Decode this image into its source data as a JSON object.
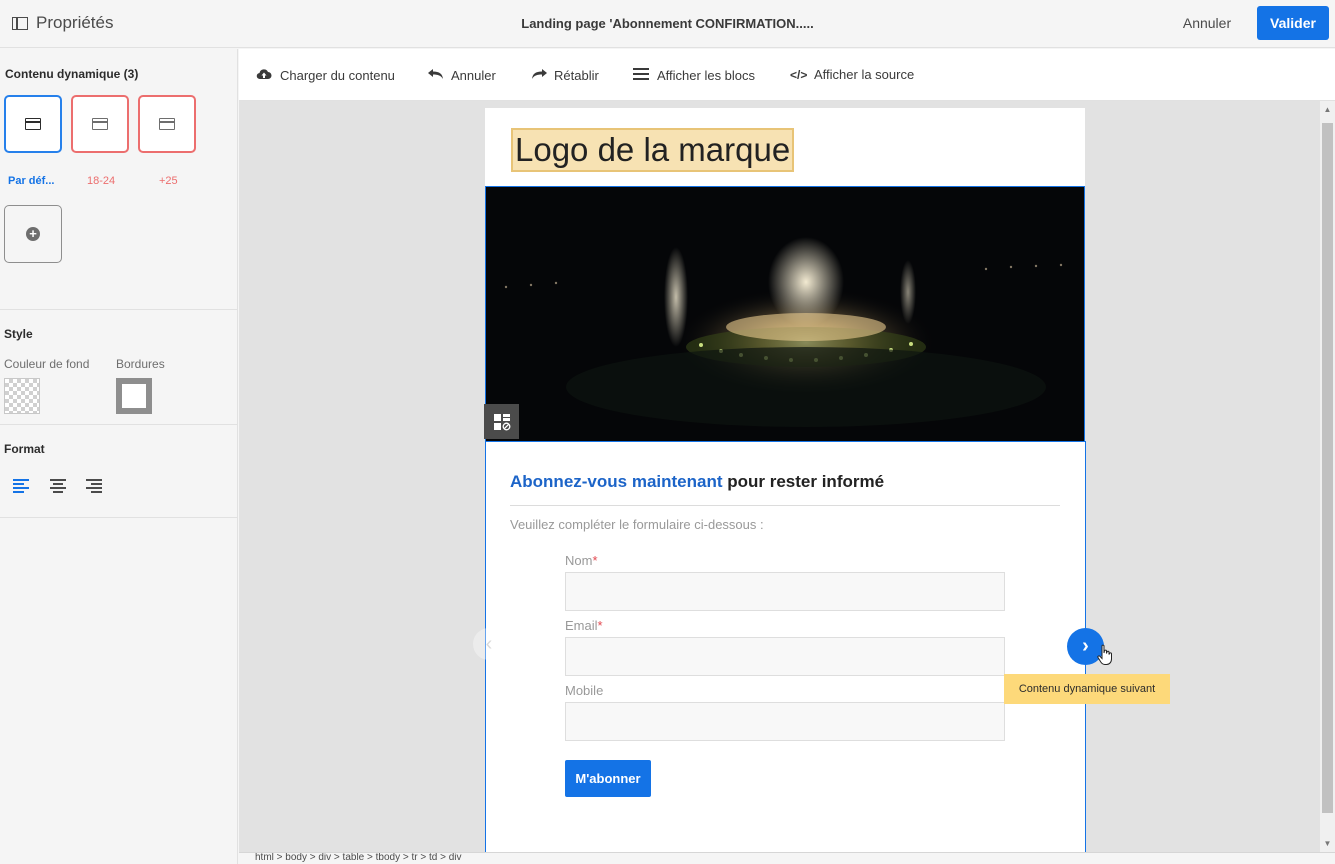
{
  "topbar": {
    "panel_title": "Propriétés",
    "doc_title": "Landing page 'Abonnement CONFIRMATION.....",
    "cancel_label": "Annuler",
    "validate_label": "Valider"
  },
  "left_panel": {
    "dynamic_title": "Contenu dynamique (3)",
    "variants": [
      {
        "label": "Par déf...",
        "icon": "window-icon",
        "state": "selected"
      },
      {
        "label": "18-24",
        "icon": "window-icon",
        "state": "variant"
      },
      {
        "label": "+25",
        "icon": "window-icon",
        "state": "variant"
      }
    ],
    "add_icon": "plus-circle-icon",
    "style_title": "Style",
    "bg_color_label": "Couleur de fond",
    "borders_label": "Bordures",
    "format_title": "Format",
    "alignments": [
      "align-left-icon",
      "align-center-icon",
      "align-right-icon"
    ]
  },
  "toolbar": {
    "load_label": "Charger du contenu",
    "undo_label": "Annuler",
    "redo_label": "Rétablir",
    "blocks_label": "Afficher les blocs",
    "source_label": "Afficher la source"
  },
  "page": {
    "logo_text": "Logo de la marque",
    "headline_blue": "Abonnez-vous maintenant",
    "headline_rest": " pour rester informé",
    "intro": "Veuillez compléter le formulaire ci-dessous :",
    "fields": [
      {
        "label": "Nom",
        "required": "*"
      },
      {
        "label": "Email",
        "required": "*"
      },
      {
        "label": "Mobile",
        "required": ""
      }
    ],
    "subscribe_label": "M'abonner"
  },
  "navigation": {
    "next_tooltip": "Contenu dynamique suivant"
  },
  "statusbar": {
    "path": "html > body > div > table > tbody > tr > td > div"
  },
  "colors": {
    "accent": "#1473e6",
    "variant_border": "#ec6e6e",
    "logo_bg": "#f7e2b3",
    "tooltip_bg": "#fdd97a"
  }
}
